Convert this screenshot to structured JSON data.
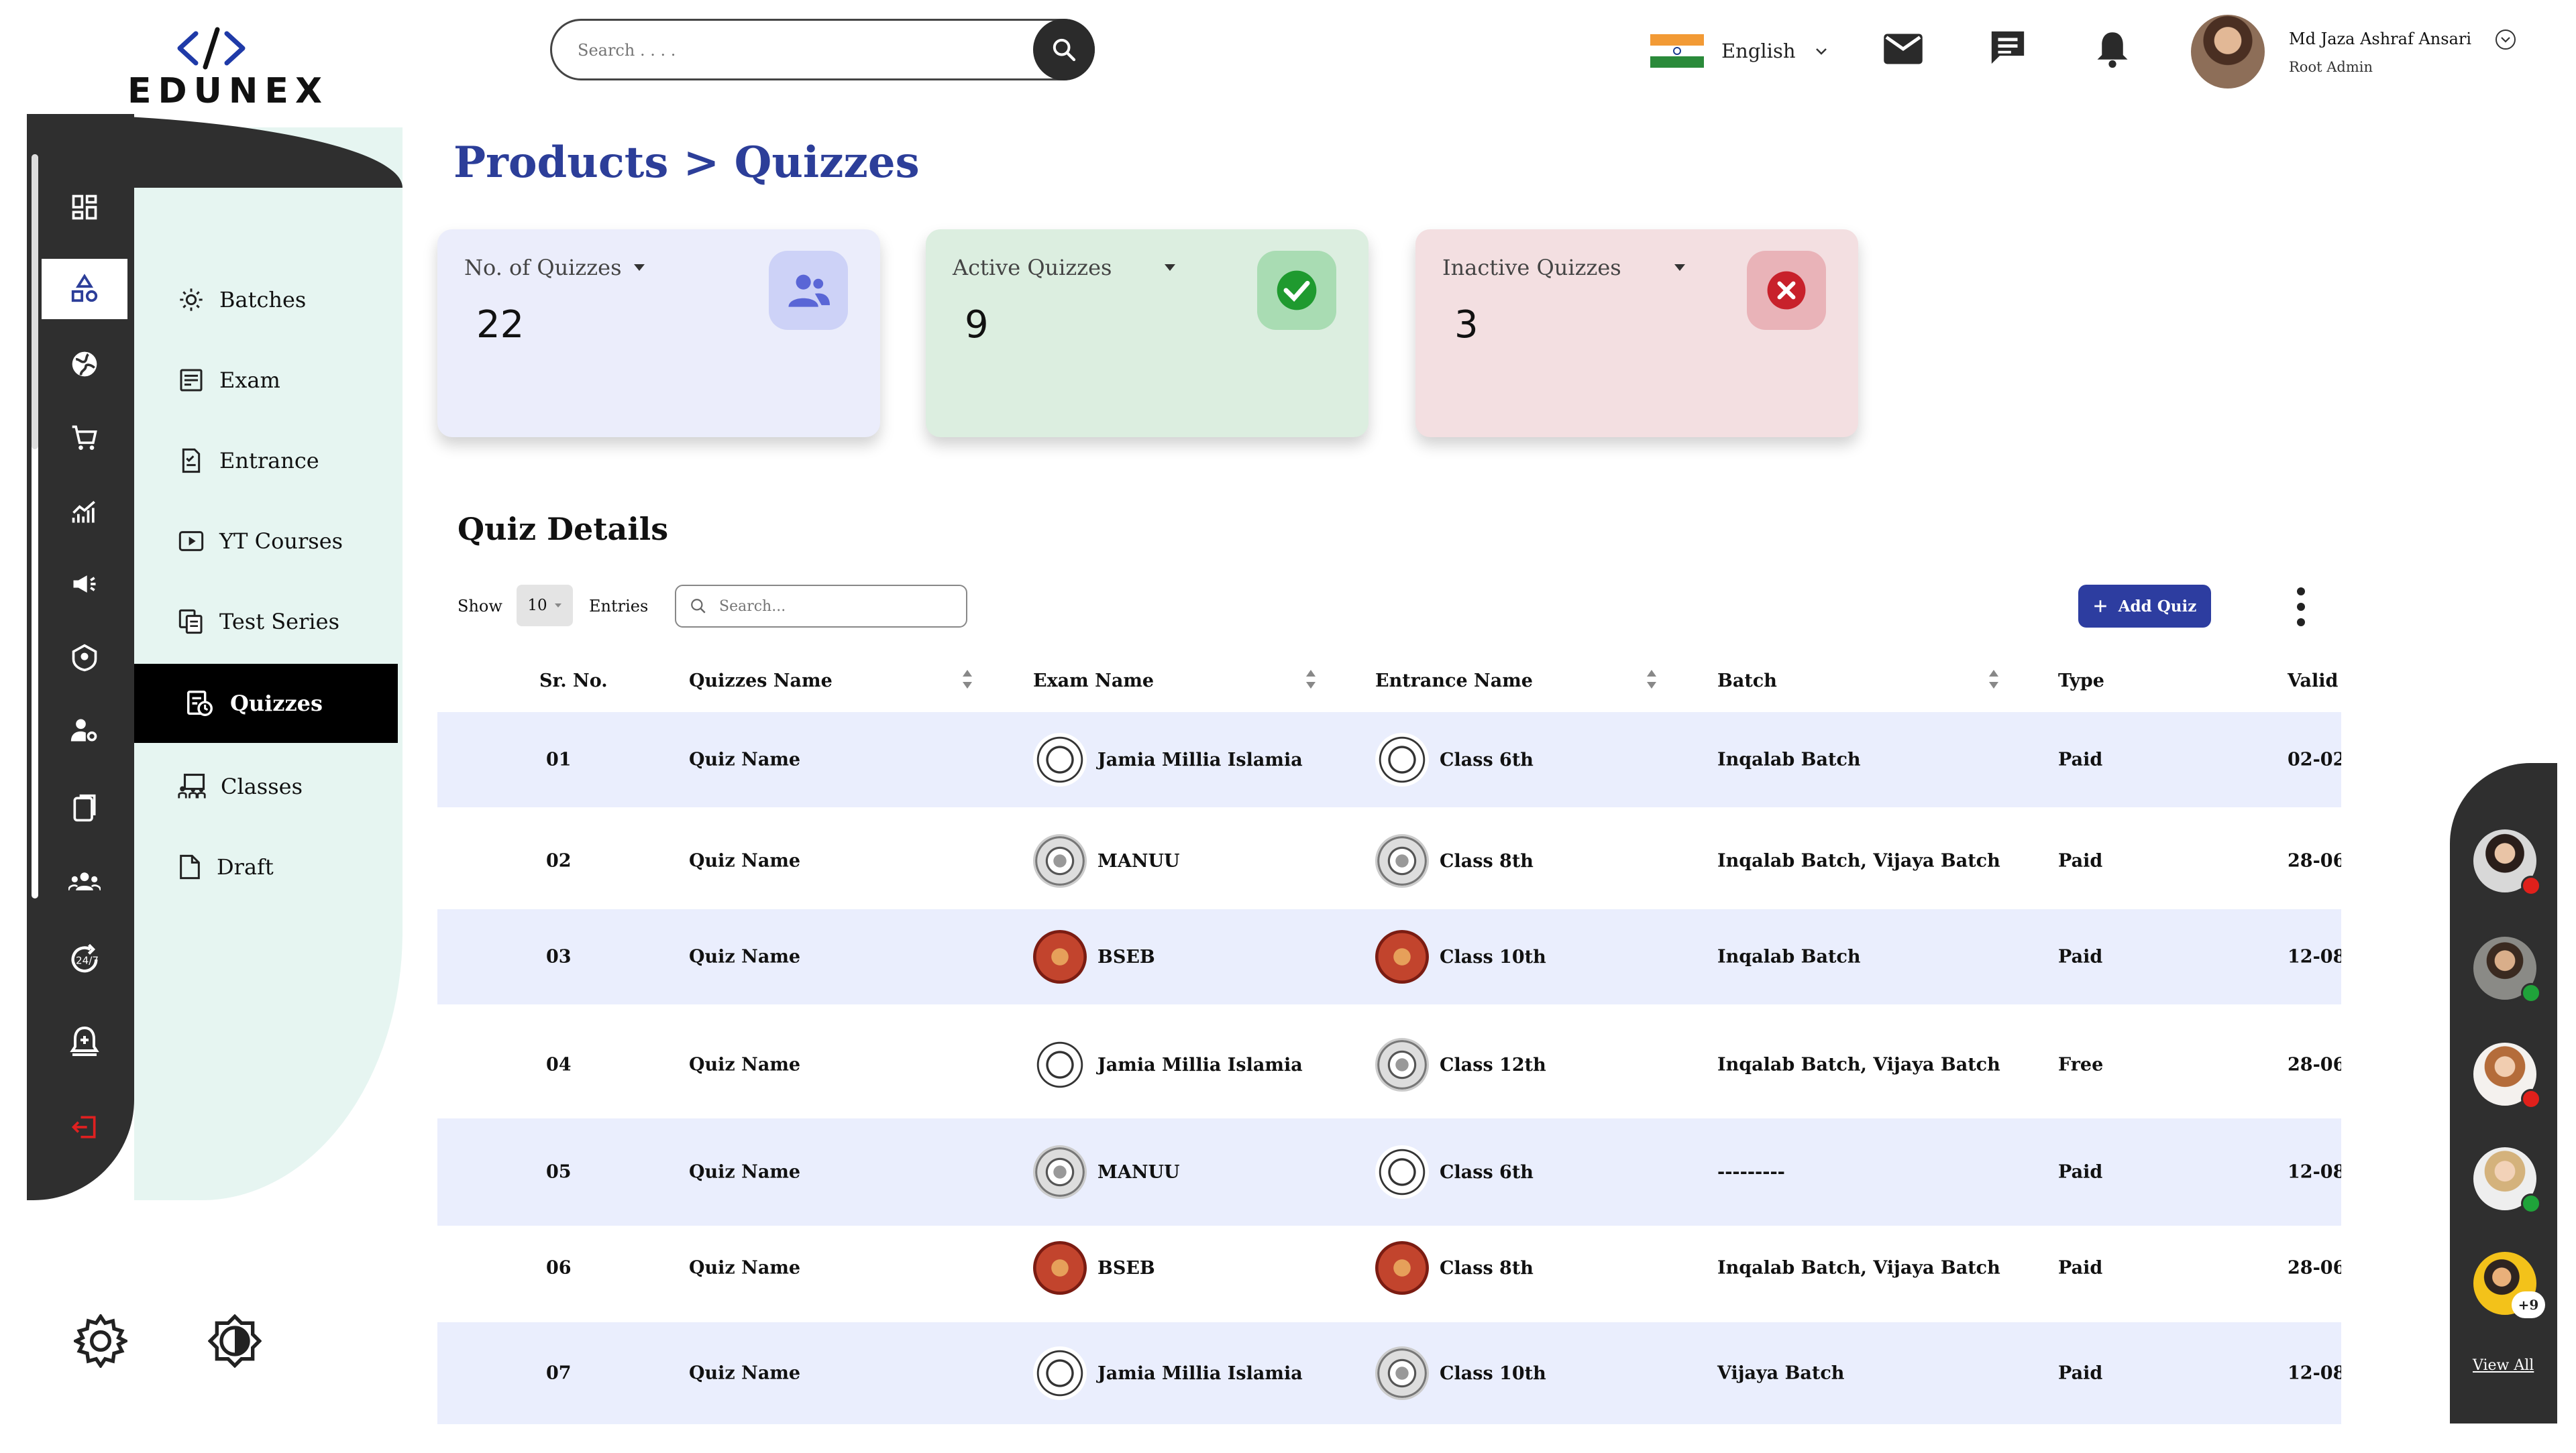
{
  "brand": {
    "logo_text": "EDUNEX"
  },
  "header": {
    "search_placeholder": "Search . . . .",
    "language": "English",
    "user": {
      "name": "Md Jaza Ashraf Ansari",
      "role": "Root Admin"
    }
  },
  "subnav": {
    "items": [
      {
        "label": "Batches",
        "icon": "batches-icon"
      },
      {
        "label": "Exam",
        "icon": "exam-icon"
      },
      {
        "label": "Entrance",
        "icon": "entrance-icon"
      },
      {
        "label": "YT Courses",
        "icon": "play-icon"
      },
      {
        "label": "Test Series",
        "icon": "test-series-icon"
      },
      {
        "label": "Quizzes",
        "icon": "quiz-icon",
        "active": true
      },
      {
        "label": "Classes",
        "icon": "classes-icon"
      },
      {
        "label": "Draft",
        "icon": "draft-icon"
      }
    ]
  },
  "breadcrumb": "Products > Quizzes",
  "cards": [
    {
      "title": "No. of Quizzes",
      "value": "22",
      "bg": "#ebedfb",
      "icon_bg": "#cdd2f7",
      "icon": "users-icon"
    },
    {
      "title": "Active Quizzes",
      "value": "9",
      "bg": "#dceee0",
      "icon_bg": "#a9dcb3",
      "icon": "check-icon"
    },
    {
      "title": "Inactive Quizzes",
      "value": "3",
      "bg": "#f3dfe1",
      "icon_bg": "#e9b3b8",
      "icon": "x-icon"
    }
  ],
  "quiz_details": {
    "title": "Quiz Details",
    "show_label": "Show",
    "show_value": "10",
    "entries_label": "Entries",
    "search_placeholder": "Search...",
    "add_button": "Add Quiz"
  },
  "table": {
    "columns": [
      "Sr. No.",
      "Quizzes Name",
      "Exam Name",
      "Entrance Name",
      "Batch",
      "Type",
      "Valid"
    ],
    "rows": [
      {
        "sr": "01",
        "name": "Quiz Name",
        "exam": "Jamia Millia Islamia",
        "exam_seal": "jmi",
        "entrance": "Class 6th",
        "entrance_seal": "jmi",
        "batch": "Inqalab Batch",
        "type": "Paid",
        "valid": "02-02-"
      },
      {
        "sr": "02",
        "name": "Quiz Name",
        "exam": "MANUU",
        "exam_seal": "manuu",
        "entrance": "Class 8th",
        "entrance_seal": "manuu",
        "batch": "Inqalab Batch, Vijaya Batch",
        "type": "Paid",
        "valid": "28-06-"
      },
      {
        "sr": "03",
        "name": "Quiz Name",
        "exam": "BSEB",
        "exam_seal": "bseb",
        "entrance": "Class 10th",
        "entrance_seal": "bseb",
        "batch": "Inqalab Batch",
        "type": "Paid",
        "valid": "12-08-"
      },
      {
        "sr": "04",
        "name": "Quiz Name",
        "exam": "Jamia Millia Islamia",
        "exam_seal": "jmi",
        "entrance": "Class 12th",
        "entrance_seal": "manuu",
        "batch": "Inqalab Batch, Vijaya Batch",
        "type": "Free",
        "valid": "28-06-"
      },
      {
        "sr": "05",
        "name": "Quiz Name",
        "exam": "MANUU",
        "exam_seal": "manuu",
        "entrance": "Class 6th",
        "entrance_seal": "jmi",
        "batch": "---------",
        "type": "Paid",
        "valid": "12-08-"
      },
      {
        "sr": "06",
        "name": "Quiz Name",
        "exam": "BSEB",
        "exam_seal": "bseb",
        "entrance": "Class 8th",
        "entrance_seal": "bseb",
        "batch": "Inqalab Batch, Vijaya Batch",
        "type": "Paid",
        "valid": "28-06-"
      },
      {
        "sr": "07",
        "name": "Quiz Name",
        "exam": "Jamia Millia Islamia",
        "exam_seal": "jmi",
        "entrance": "Class 10th",
        "entrance_seal": "manuu",
        "batch": "Vijaya Batch",
        "type": "Paid",
        "valid": "12-08-"
      }
    ]
  },
  "chat": {
    "contacts": [
      {
        "status": "offline",
        "status_color": "#e0201b"
      },
      {
        "status": "online",
        "status_color": "#1fa33a"
      },
      {
        "status": "offline",
        "status_color": "#e0201b"
      },
      {
        "status": "online",
        "status_color": "#1fa33a"
      }
    ],
    "more_count": "+9",
    "view_all": "View All"
  },
  "colors": {
    "accent": "#2c3e99",
    "dark": "#2f2f2f",
    "mint": "#e6f5f1"
  }
}
